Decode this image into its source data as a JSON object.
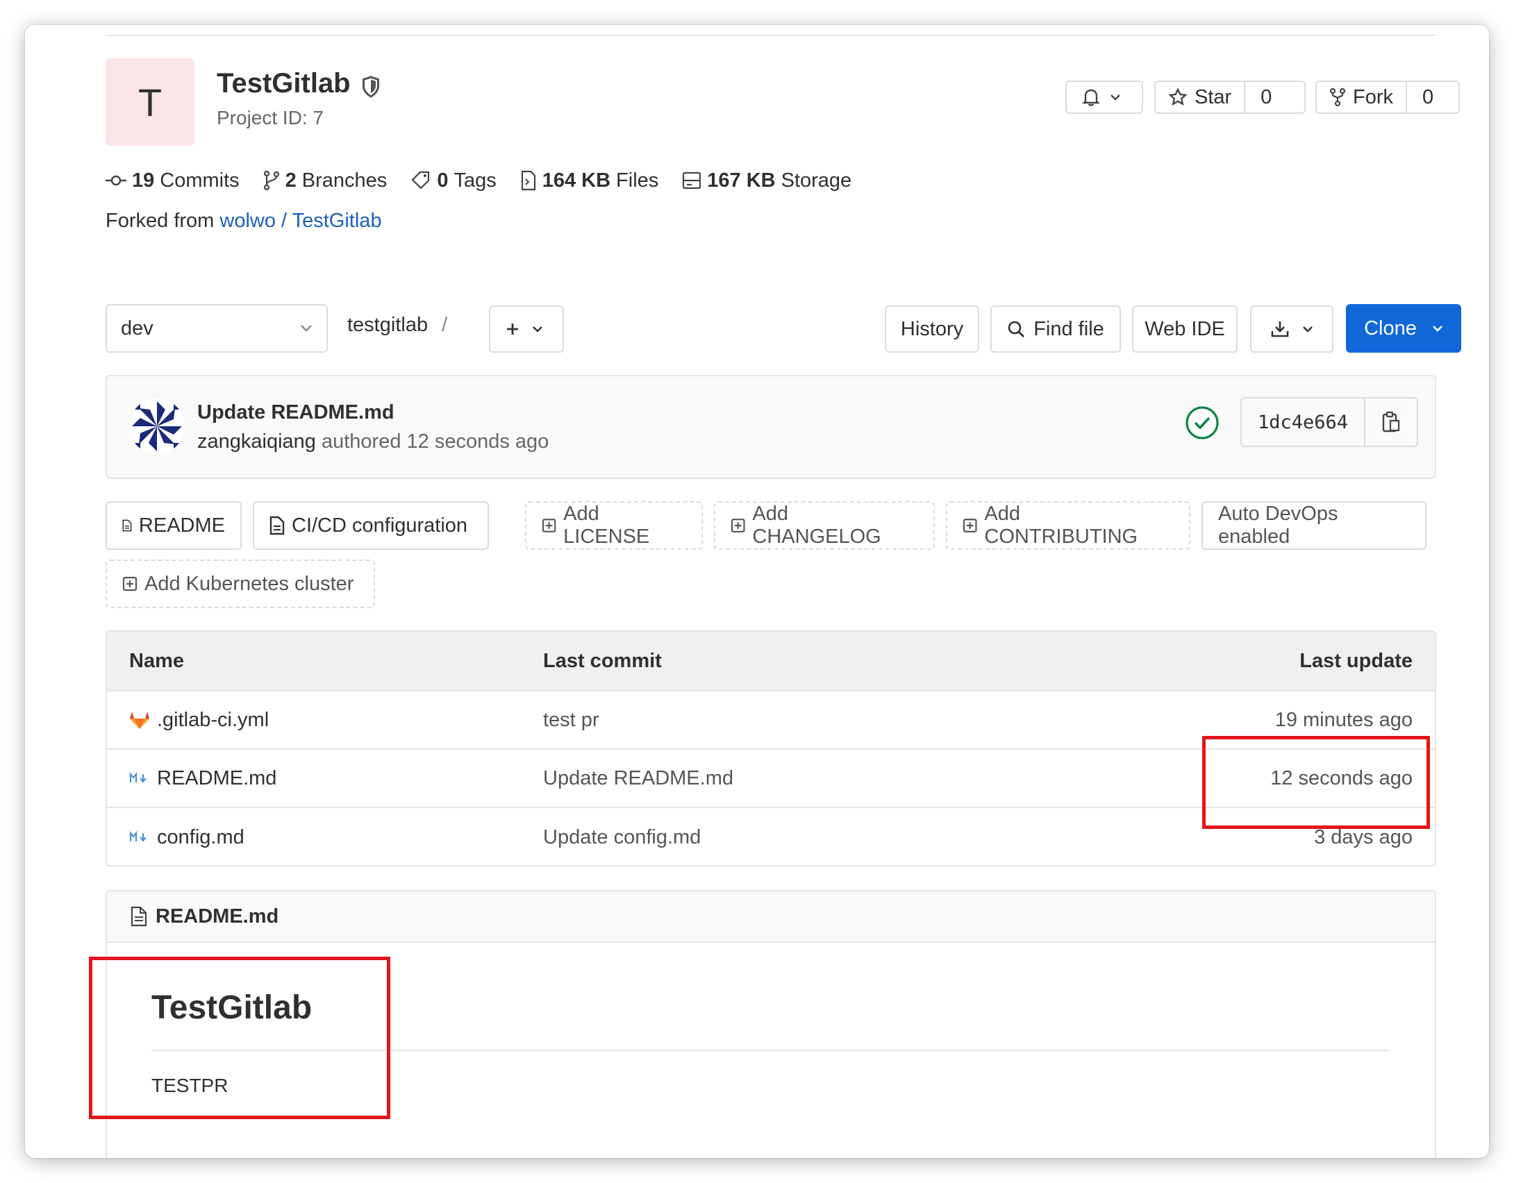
{
  "project": {
    "avatar_letter": "T",
    "name": "TestGitlab",
    "id_text": "Project ID: 7"
  },
  "actions": {
    "star_label": "Star",
    "star_count": "0",
    "fork_label": "Fork",
    "fork_count": "0"
  },
  "stats": {
    "commits_count": "19",
    "commits_label": "Commits",
    "branches_count": "2",
    "branches_label": "Branches",
    "tags_count": "0",
    "tags_label": "Tags",
    "files_size": "164 KB",
    "files_label": "Files",
    "storage_size": "167 KB",
    "storage_label": "Storage"
  },
  "fork": {
    "prefix": "Forked from",
    "source": "wolwo / TestGitlab"
  },
  "toolbar": {
    "branch": "dev",
    "path": "testgitlab",
    "separator": "/",
    "history": "History",
    "find_file": "Find file",
    "web_ide": "Web IDE",
    "clone": "Clone"
  },
  "last_commit": {
    "title": "Update README.md",
    "author": "zangkaiqiang",
    "meta": "authored 12 seconds ago",
    "sha": "1dc4e664"
  },
  "quick_links": [
    {
      "label": "README"
    },
    {
      "label": "CI/CD configuration"
    },
    {
      "label": "Add LICENSE"
    },
    {
      "label": "Add CHANGELOG"
    },
    {
      "label": "Add CONTRIBUTING"
    },
    {
      "label": "Auto DevOps enabled"
    },
    {
      "label": "Add Kubernetes cluster"
    }
  ],
  "file_table": {
    "headers": {
      "name": "Name",
      "commit": "Last commit",
      "update": "Last update"
    },
    "rows": [
      {
        "name": ".gitlab-ci.yml",
        "commit": "test pr",
        "update": "19 minutes ago",
        "icon": "gitlab-icon"
      },
      {
        "name": "README.md",
        "commit": "Update README.md",
        "update": "12 seconds ago",
        "icon": "markdown-icon"
      },
      {
        "name": "config.md",
        "commit": "Update config.md",
        "update": "3 days ago",
        "icon": "markdown-icon"
      }
    ]
  },
  "readme": {
    "filename": "README.md",
    "heading": "TestGitlab",
    "body": "TESTPR"
  },
  "colors": {
    "primary": "#1068d8",
    "link": "#1f5fb8",
    "success": "#108548",
    "annotation": "#e3151a",
    "avatar_tile": "#fbe5e7"
  }
}
